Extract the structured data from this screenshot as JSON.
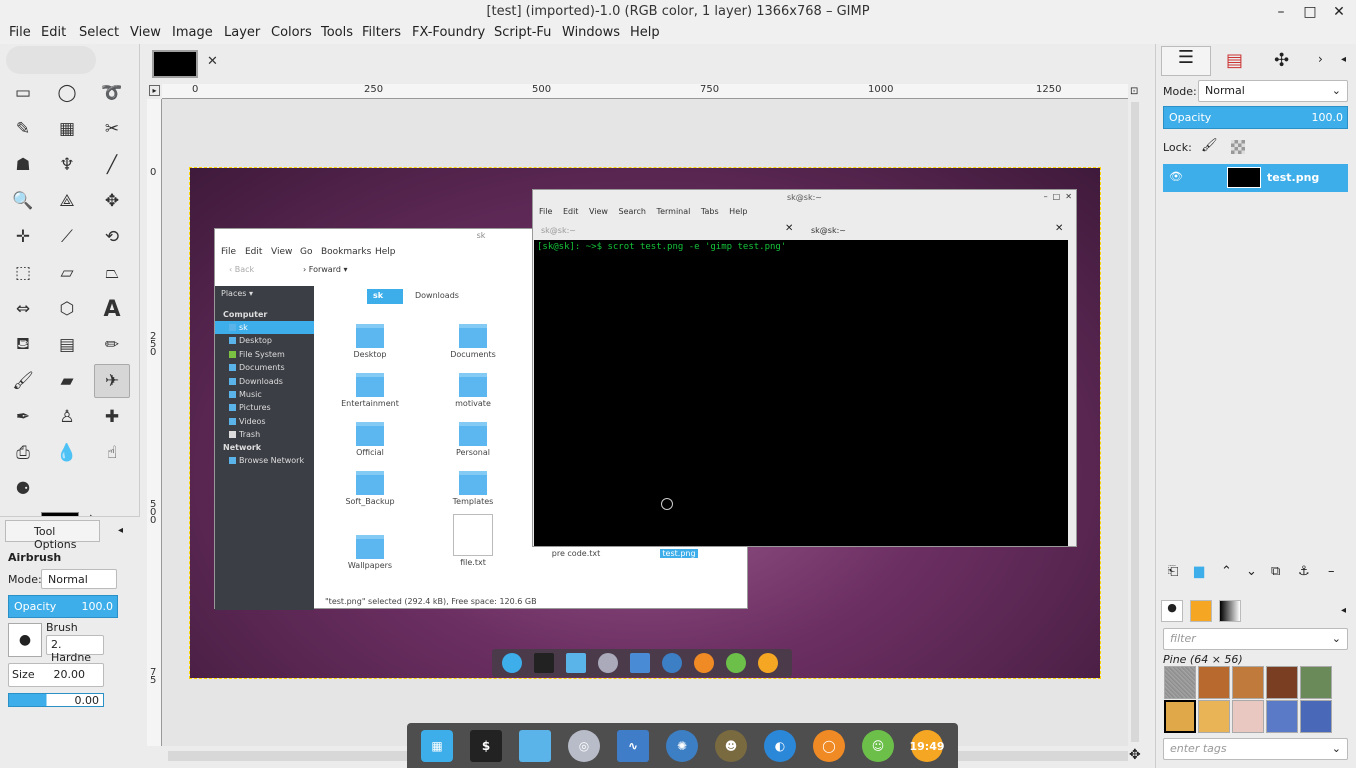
{
  "window": {
    "title": "[test] (imported)-1.0 (RGB color, 1 layer) 1366x768 – GIMP",
    "minimize": "–",
    "maximize": "□",
    "close": "✕"
  },
  "menu": [
    "File",
    "Edit",
    "Select",
    "View",
    "Image",
    "Layer",
    "Colors",
    "Tools",
    "Filters",
    "FX-Foundry",
    "Script-Fu",
    "Windows",
    "Help"
  ],
  "image_tab": {
    "close": "✕"
  },
  "ruler": {
    "h": [
      "0",
      "250",
      "500",
      "750",
      "1000",
      "1250"
    ],
    "v": [
      "0",
      "2\n5\n0",
      "5\n0\n0",
      "7\n5"
    ]
  },
  "tool_options": {
    "tab_label": "Tool Options",
    "tool_name": "Airbrush",
    "mode_label": "Mode:",
    "mode_value": "Normal",
    "opacity_label": "Opacity",
    "opacity_value": "100.0",
    "brush_label": "Brush",
    "brush_value": "2. Hardne",
    "size_label": "Size",
    "size_value": "20.00",
    "aspect_value": "0.00"
  },
  "screenshot": {
    "file_manager": {
      "title": "sk",
      "menu": [
        "File",
        "Edit",
        "View",
        "Go",
        "Bookmarks",
        "Help"
      ],
      "back": "Back",
      "forward": "Forward",
      "places": "Places",
      "crumb_current": "sk",
      "crumb_next": "Downloads",
      "side_header_computer": "Computer",
      "side_items": [
        "sk",
        "Desktop",
        "File System",
        "Documents",
        "Downloads",
        "Music",
        "Pictures",
        "Videos",
        "Trash"
      ],
      "side_header_network": "Network",
      "side_network_item": "Browse Network",
      "folders": [
        "Desktop",
        "Documents",
        "Entertainment",
        "motivate",
        "Official",
        "Personal",
        "Soft_Backup",
        "Templates",
        "Wallpapers",
        "file.txt",
        "pre code.txt",
        "test.png"
      ],
      "status": "\"test.png\" selected (292.4 kB), Free space: 120.6 GB"
    },
    "terminal": {
      "title": "sk@sk:~",
      "menu": [
        "File",
        "Edit",
        "View",
        "Search",
        "Terminal",
        "Tabs",
        "Help"
      ],
      "tab1": "sk@sk:~",
      "tab2": "sk@sk:~",
      "prompt": "[sk@sk]: ~>$ scrot test.png -e 'gimp test.png'"
    }
  },
  "layers": {
    "mode_label": "Mode:",
    "mode_value": "Normal",
    "opacity_label": "Opacity",
    "opacity_value": "100.0",
    "lock_label": "Lock:",
    "layer_name": "test.png"
  },
  "patterns": {
    "filter_placeholder": "filter",
    "current": "Pine (64 × 56)",
    "tags_placeholder": "enter tags"
  },
  "dock_clock": "19:49",
  "colors": {
    "accent": "#3daee9",
    "terminal_green": "#15c33a"
  }
}
